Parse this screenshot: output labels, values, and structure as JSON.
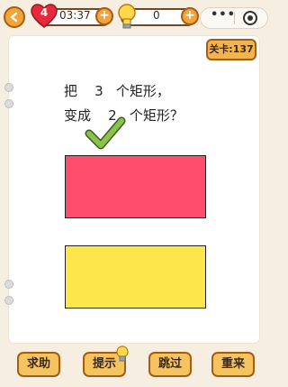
{
  "header": {
    "lives": "4",
    "timer": "03:37",
    "hint_count": "0",
    "menu_dots": "•••"
  },
  "level": {
    "label": "关卡:137"
  },
  "question": {
    "line1": "把    3   个矩形，",
    "line2": "变成    2   个矩形？"
  },
  "shapes": {
    "rect1_color": "#ff4d6d",
    "rect2_color": "#fce64c"
  },
  "footer": {
    "help_label": "求助",
    "hint_label": "提示",
    "skip_label": "跳过",
    "restart_label": "重来"
  },
  "colors": {
    "accent_orange": "#f2a33a",
    "background": "#f6eee0",
    "check_green": "#8bc34a"
  },
  "icons": [
    "back-arrow-icon",
    "heart-icon",
    "plus-icon",
    "lightbulb-icon",
    "menu-dots-icon",
    "target-icon",
    "checkmark-icon"
  ]
}
